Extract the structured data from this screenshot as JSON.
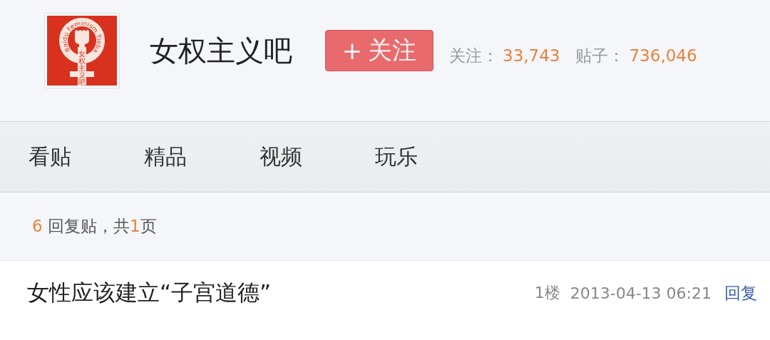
{
  "forum": {
    "logo": {
      "arc_text": "Baidu Feminism Tieba",
      "stem_text": "女权主义吧"
    },
    "name": "女权主义吧",
    "follow_button": {
      "icon": "+",
      "label": "关注"
    },
    "stats": [
      {
        "label": "关注：",
        "value": "33,743"
      },
      {
        "label": "贴子：",
        "value": "736,046"
      }
    ]
  },
  "tabs": [
    {
      "label": "看贴",
      "selected": false
    },
    {
      "label": "精品",
      "selected": false
    },
    {
      "label": "视频",
      "selected": false
    },
    {
      "label": "玩乐",
      "selected": false
    }
  ],
  "summary": {
    "reply_count": "6",
    "reply_label": "回复贴，共",
    "page_count": "1",
    "page_unit": "页"
  },
  "post": {
    "title": "女性应该建立“子宫道德”",
    "floor": "1楼",
    "time": "2013-04-13 06:21",
    "reply_link": "回复"
  }
}
